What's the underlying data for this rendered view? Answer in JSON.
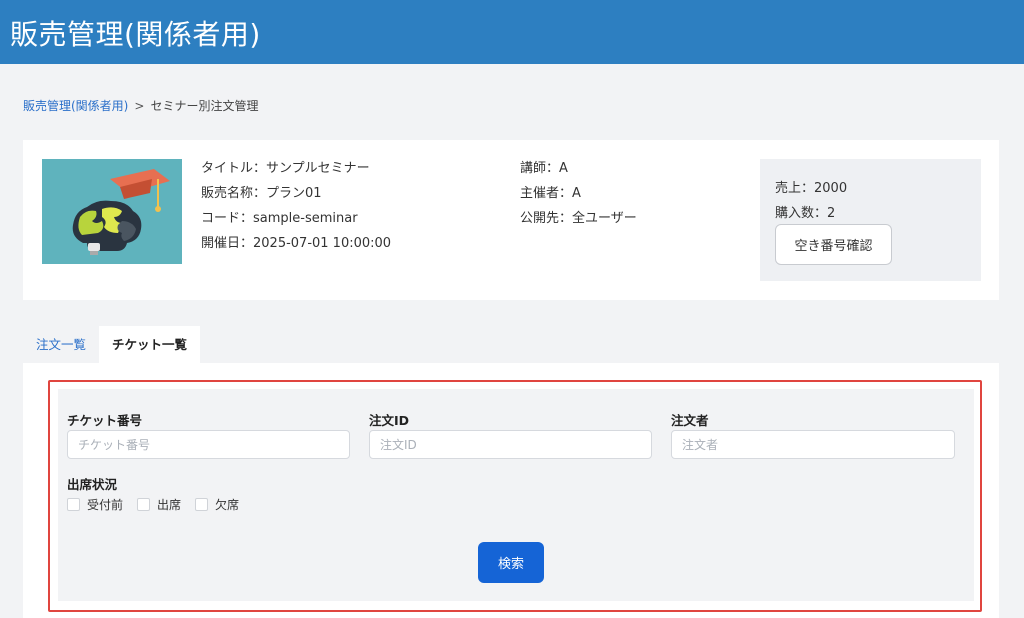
{
  "header": {
    "title": "販売管理(関係者用)"
  },
  "breadcrumb": {
    "parent": "販売管理(関係者用)",
    "separator": ">",
    "current": "セミナー別注文管理"
  },
  "seminar": {
    "title": "タイトル：サンプルセミナー",
    "plan": "販売名称：プラン01",
    "code": "コード：sample-seminar",
    "date": "開催日：2025-07-01 10:00:00",
    "instructor": "講師：A",
    "organizer": "主催者：A",
    "visibility": "公開先：全ユーザー"
  },
  "sales": {
    "total": "売上：2000",
    "count": "購入数：2",
    "check_button": "空き番号確認"
  },
  "tabs": [
    {
      "label": "注文一覧",
      "active": false
    },
    {
      "label": "チケット一覧",
      "active": true
    }
  ],
  "search": {
    "ticket_label": "チケット番号",
    "ticket_placeholder": "チケット番号",
    "order_id_label": "注文ID",
    "order_id_placeholder": "注文ID",
    "orderer_label": "注文者",
    "orderer_placeholder": "注文者",
    "attendance_label": "出席状況",
    "attendance_options": [
      "受付前",
      "出席",
      "欠席"
    ],
    "search_button": "検索"
  },
  "colors": {
    "header": "#2d7fc1",
    "primary_button": "#1564d6",
    "highlight_border": "#e0453f"
  }
}
